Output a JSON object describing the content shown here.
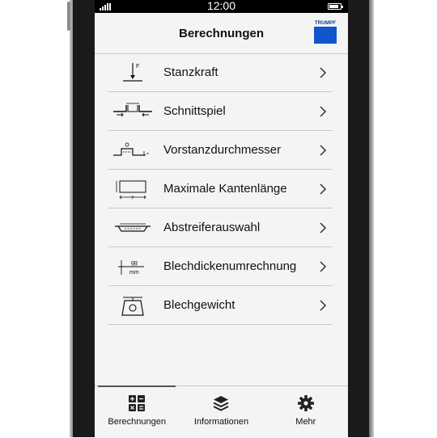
{
  "status_bar": {
    "time": "12:00",
    "battery_level": 0.85
  },
  "header": {
    "title": "Berechnungen",
    "brand": "TRUMPF",
    "brand_color": "#1155cc"
  },
  "list": {
    "items": [
      {
        "label": "Stanzkraft",
        "icon": "punch-force-icon"
      },
      {
        "label": "Schnittspiel",
        "icon": "cutting-clearance-icon"
      },
      {
        "label": "Vorstanzdurchmesser",
        "icon": "prepunch-diameter-icon"
      },
      {
        "label": "Maximale Kantenlänge",
        "icon": "max-edge-length-icon"
      },
      {
        "label": "Abstreiferauswahl",
        "icon": "stripper-selection-icon"
      },
      {
        "label": "Blechdickenumrechnung",
        "icon": "sheet-thickness-conversion-icon"
      },
      {
        "label": "Blechgewicht",
        "icon": "sheet-weight-icon"
      }
    ]
  },
  "tabs": [
    {
      "label": "Berechnungen",
      "icon": "calculator-icon",
      "active": true
    },
    {
      "label": "Informationen",
      "icon": "layers-icon",
      "active": false
    },
    {
      "label": "Mehr",
      "icon": "gear-icon",
      "active": false
    }
  ],
  "icon_glyphs": {
    "force_label": "F",
    "gauge_top": "gg",
    "gauge_bottom": "mm",
    "question": "?"
  }
}
